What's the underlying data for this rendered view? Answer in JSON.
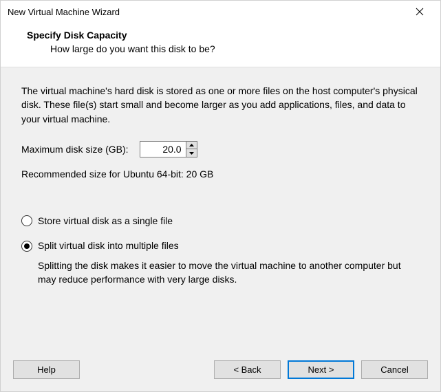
{
  "window": {
    "title": "New Virtual Machine Wizard"
  },
  "header": {
    "title": "Specify Disk Capacity",
    "subtitle": "How large do you want this disk to be?"
  },
  "content": {
    "description": "The virtual machine's hard disk is stored as one or more files on the host computer's physical disk. These file(s) start small and become larger as you add applications, files, and data to your virtual machine.",
    "size_label": "Maximum disk size (GB):",
    "size_value": "20.0",
    "recommended": "Recommended size for Ubuntu 64-bit: 20 GB",
    "radio_single": "Store virtual disk as a single file",
    "radio_split": "Split virtual disk into multiple files",
    "split_note": "Splitting the disk makes it easier to move the virtual machine to another computer but may reduce performance with very large disks.",
    "selected_option": "split"
  },
  "buttons": {
    "help": "Help",
    "back": "< Back",
    "next": "Next >",
    "cancel": "Cancel"
  }
}
